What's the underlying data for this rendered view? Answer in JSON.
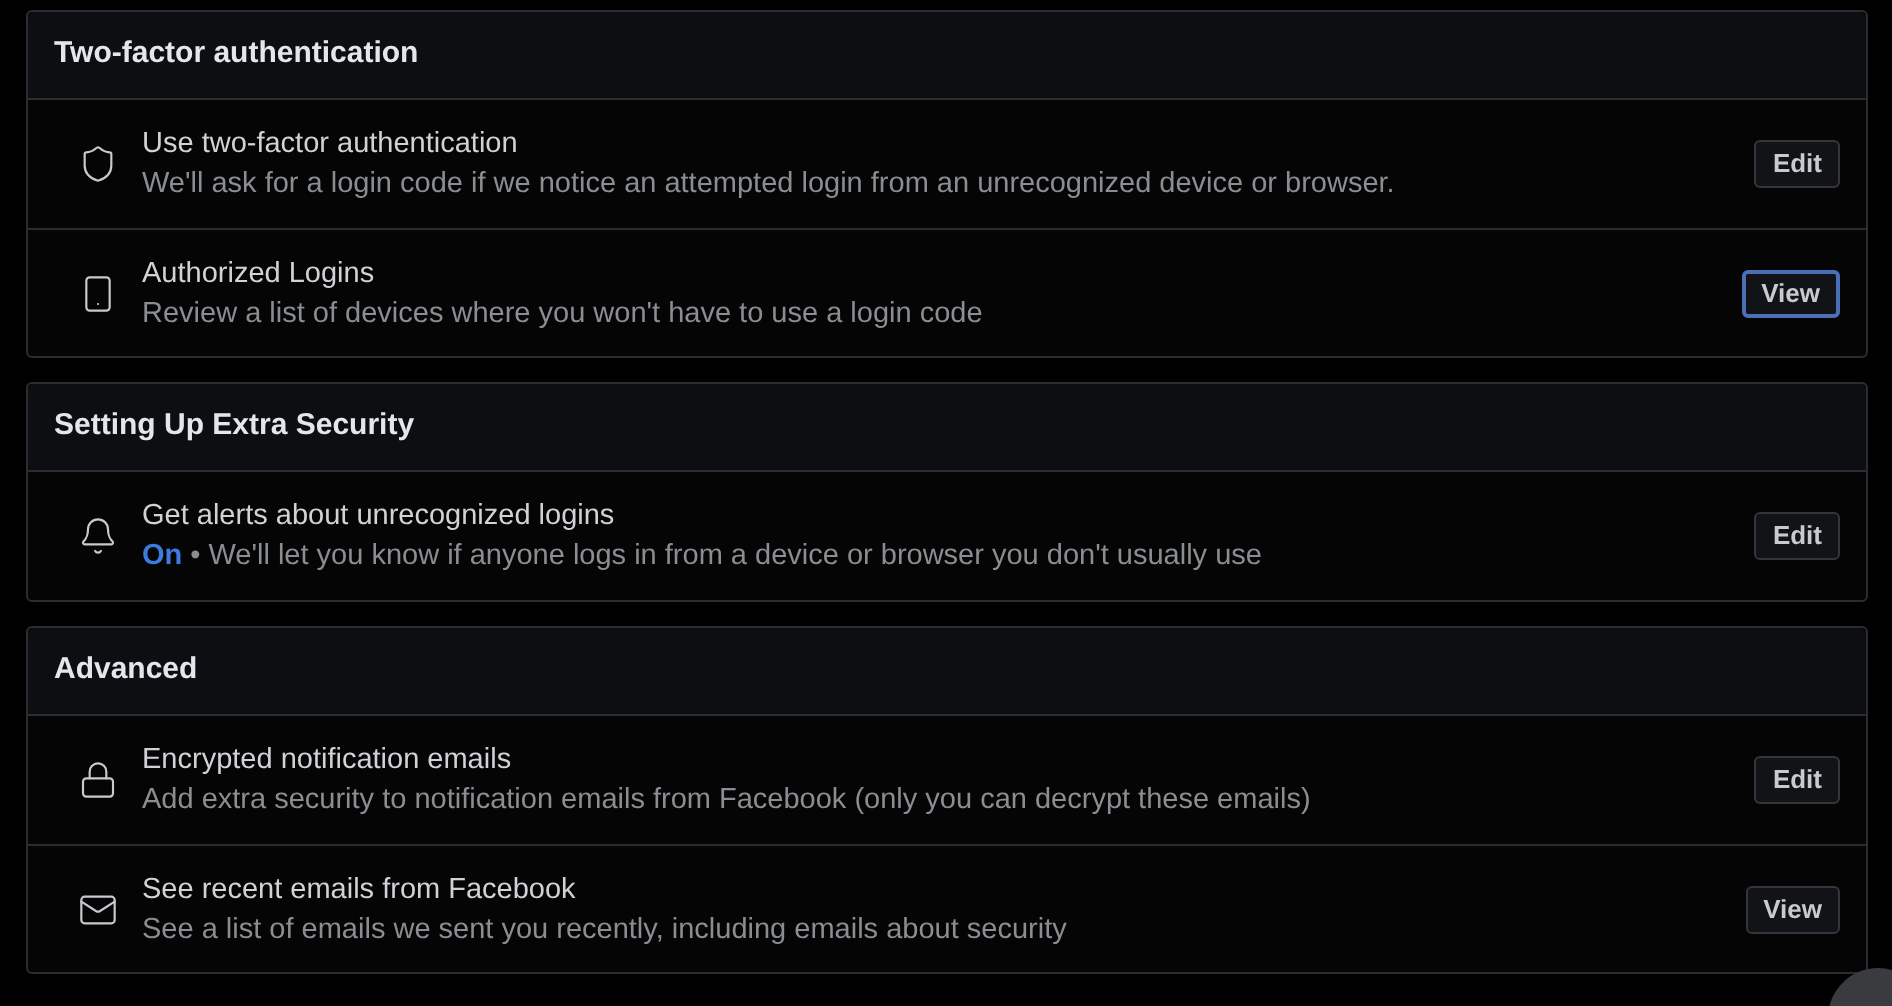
{
  "sections": [
    {
      "title": "Two-factor authentication",
      "items": [
        {
          "kind": "shield",
          "title": "Use two-factor authentication",
          "description": "We'll ask for a login code if we notice an attempted login from an unrecognized device or browser.",
          "button": "Edit",
          "focused": false
        },
        {
          "kind": "phone",
          "title": "Authorized Logins",
          "description": "Review a list of devices where you won't have to use a login code",
          "button": "View",
          "focused": true
        }
      ]
    },
    {
      "title": "Setting Up Extra Security",
      "items": [
        {
          "kind": "bell",
          "title": "Get alerts about unrecognized logins",
          "status": "On",
          "separator": "•",
          "description": "We'll let you know if anyone logs in from a device or browser you don't usually use",
          "button": "Edit",
          "focused": false
        }
      ]
    },
    {
      "title": "Advanced",
      "items": [
        {
          "kind": "lock",
          "title": "Encrypted notification emails",
          "description": "Add extra security to notification emails from Facebook (only you can decrypt these emails)",
          "button": "Edit",
          "focused": false
        },
        {
          "kind": "mail",
          "title": "See recent emails from Facebook",
          "description": "See a list of emails we sent you recently, including emails about security",
          "button": "View",
          "focused": false
        }
      ]
    }
  ]
}
